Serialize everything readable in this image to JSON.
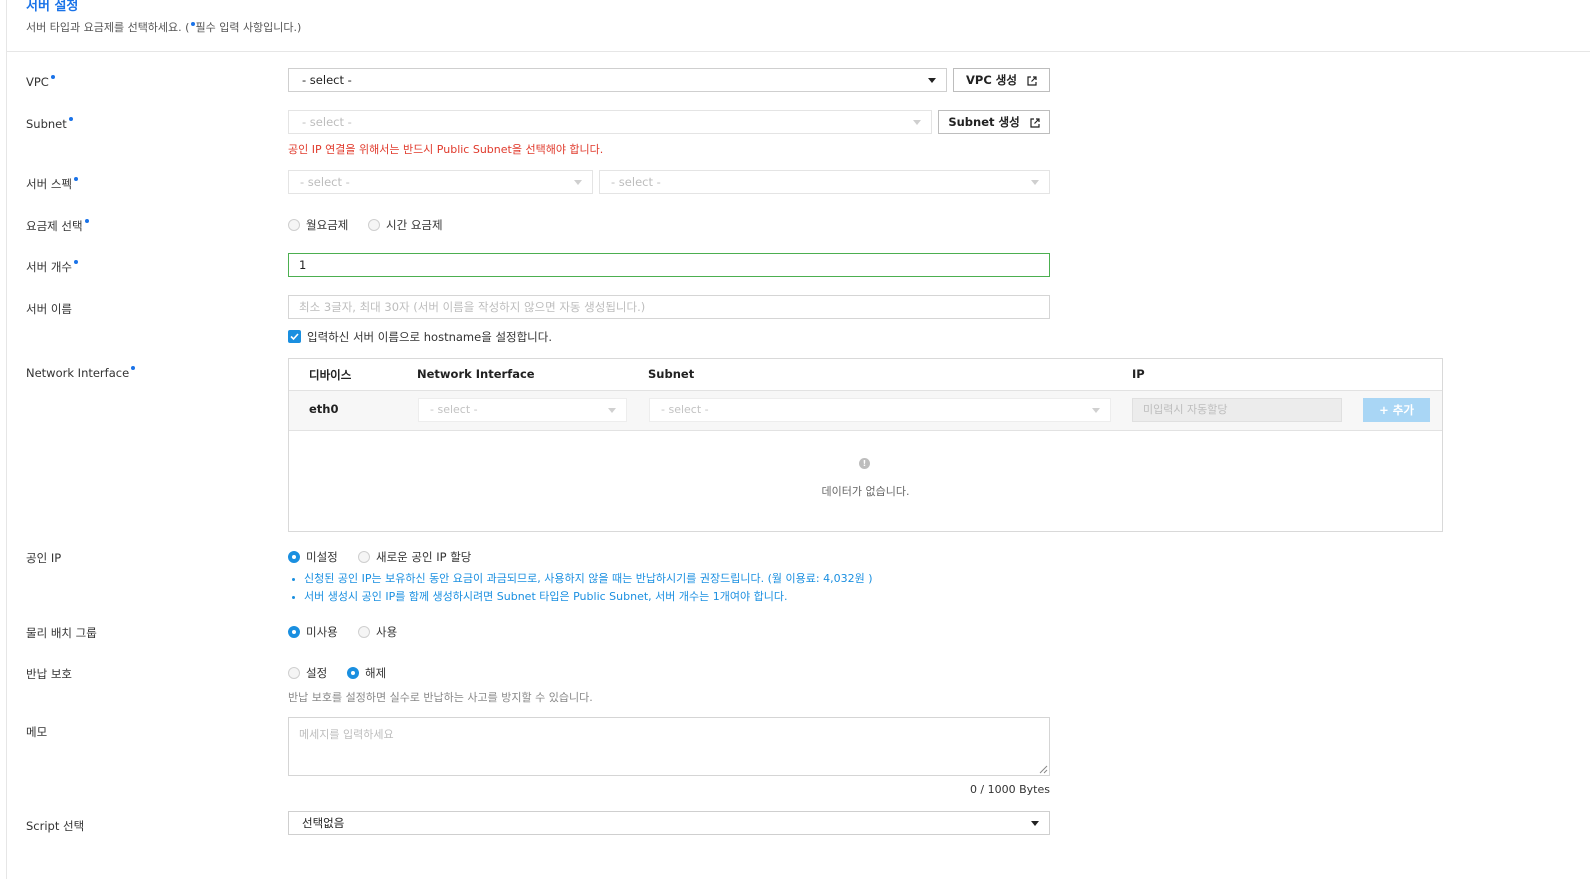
{
  "header": {
    "title": "서버 설정",
    "desc_prefix": "서버 타입과 요금제를 선택하세요. (",
    "desc_suffix": "필수 입력 사항입니다.)"
  },
  "labels": {
    "vpc": "VPC",
    "subnet": "Subnet",
    "server_spec": "서버 스펙",
    "pricing": "요금제 선택",
    "server_count": "서버 개수",
    "server_name": "서버 이름",
    "network_interface": "Network Interface",
    "public_ip": "공인 IP",
    "physical_group": "물리 배치 그룹",
    "return_protect": "반납 보호",
    "memo": "메모",
    "script": "Script 선택"
  },
  "vpc": {
    "select": "- select -",
    "create_button": "VPC 생성"
  },
  "subnet": {
    "select": "- select -",
    "create_button": "Subnet 생성",
    "warning": "공인 IP 연결을 위해서는 반드시 Public Subnet을 선택해야 합니다."
  },
  "spec": {
    "select1": "- select -",
    "select2": "- select -"
  },
  "pricing": {
    "monthly": "월요금제",
    "hourly": "시간 요금제"
  },
  "server_count": {
    "value": "1"
  },
  "server_name": {
    "placeholder": "최소 3글자, 최대 30자 (서버 이름을 작성하지 않으면 자동 생성됩니다.)",
    "hostname_check": "입력하신 서버 이름으로 hostname을 설정합니다."
  },
  "network_table": {
    "headers": [
      "디바이스",
      "Network Interface",
      "Subnet",
      "IP"
    ],
    "row": {
      "device": "eth0",
      "ni_select": "- select -",
      "subnet_select": "- select -",
      "ip_placeholder": "미입력시 자동할당",
      "add_button": "+ 추가"
    },
    "empty_text": "데이터가 없습니다."
  },
  "public_ip": {
    "opt_none": "미설정",
    "opt_new": "새로운 공인 IP 할당",
    "info1": "신청된 공인 IP는 보유하신 동안 요금이 과금되므로, 사용하지 않을 때는 반납하시기를 권장드립니다. (월 이용료: 4,032원 )",
    "info2": "서버 생성시 공인 IP를 함께 생성하시려면 Subnet 타입은 Public Subnet, 서버 개수는 1개여야 합니다."
  },
  "physical_group": {
    "opt_unused": "미사용",
    "opt_used": "사용"
  },
  "return_protect": {
    "opt_set": "설정",
    "opt_release": "해제",
    "note": "반납 보호를 설정하면 실수로 반납하는 사고를 방지할 수 있습니다."
  },
  "memo": {
    "placeholder": "메세지를 입력하세요",
    "counter": "0 / 1000 Bytes"
  },
  "script": {
    "select": "선택없음"
  },
  "colors": {
    "accent": "#1a8fe0",
    "warning": "#e0392b",
    "active_border": "#4caf50"
  }
}
